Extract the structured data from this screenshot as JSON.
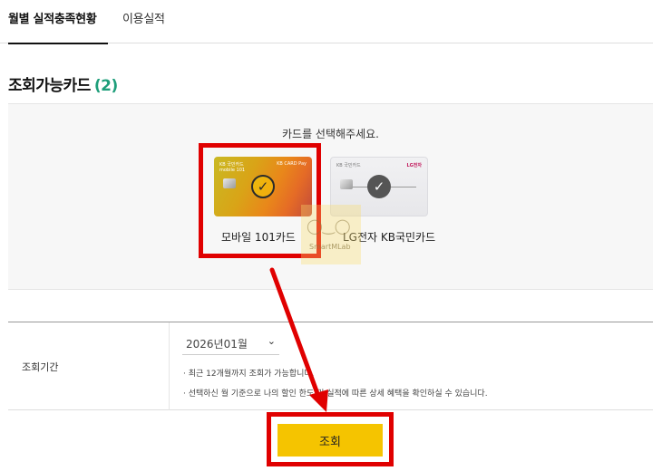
{
  "tabs": [
    {
      "label": "월별 실적충족현황",
      "active": true
    },
    {
      "label": "이용실적",
      "active": false
    }
  ],
  "section": {
    "title": "조회가능카드",
    "count": "(2)",
    "count_color": "#1e9e7a"
  },
  "card_area": {
    "instruction": "카드를 선택해주세요.",
    "cards": [
      {
        "name": "모바일 101카드",
        "selected": true,
        "brand_small": "KB 국민카드",
        "sub_small": "mobile 101",
        "logo_small": "KB CARD Pay"
      },
      {
        "name": "LG전자 KB국민카드",
        "selected": true,
        "brand_small": "KB 국민카드",
        "logo_small": "LG전자"
      }
    ]
  },
  "watermark": {
    "text": "SmartMLab"
  },
  "query": {
    "label": "조회기간",
    "period_value": "2026년01월",
    "notes": [
      "· 최근 12개월까지 조회가 가능합니다.",
      "· 선택하신 월 기준으로 나의 할인 한도 및 실적에 따른 상세 혜택을 확인하실 수 있습니다."
    ]
  },
  "button": {
    "label": "조회",
    "color": "#f5c400"
  },
  "colors": {
    "highlight": "#e00000"
  }
}
